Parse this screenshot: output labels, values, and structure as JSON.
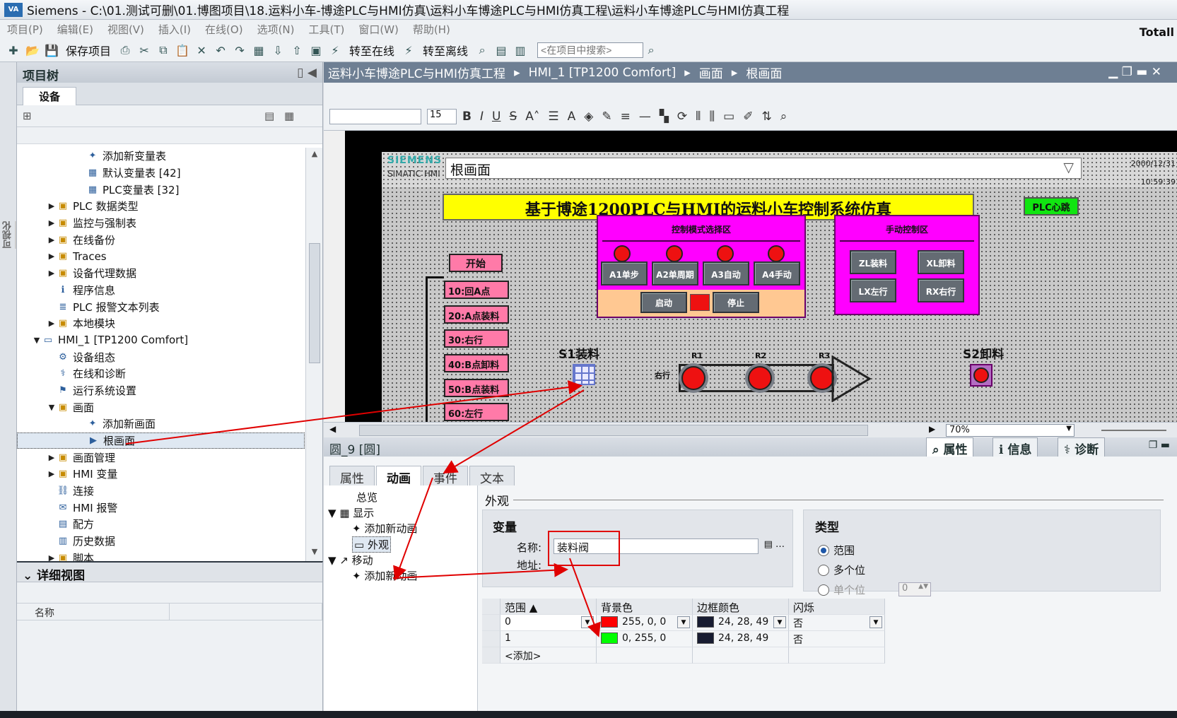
{
  "window": {
    "title": "Siemens  -  C:\\01.测试可删\\01.博图项目\\18.运料小车-博途PLC与HMI仿真\\运料小车博途PLC与HMI仿真工程\\运料小车博途PLC与HMI仿真工程",
    "logo": "VA V14",
    "brand": "Totall"
  },
  "menu": [
    "项目(P)",
    "编辑(E)",
    "视图(V)",
    "插入(I)",
    "在线(O)",
    "选项(N)",
    "工具(T)",
    "窗口(W)",
    "帮助(H)"
  ],
  "toolbar": {
    "save_label": "保存项目",
    "go_online": "转至在线",
    "go_offline": "转至离线",
    "search_placeholder": "<在项目中搜索>"
  },
  "left_strip": {
    "label": "可视化"
  },
  "project_tree": {
    "title": "项目树",
    "tab": "设备",
    "items": [
      {
        "label": "添加新变量表",
        "indent": 4,
        "arrow": "",
        "icon": "add-icon"
      },
      {
        "label": "默认变量表 [42]",
        "indent": 4,
        "arrow": "",
        "icon": "table-icon"
      },
      {
        "label": "PLC变量表 [32]",
        "indent": 4,
        "arrow": "",
        "icon": "table-icon"
      },
      {
        "label": "PLC 数据类型",
        "indent": 2,
        "arrow": "▶",
        "icon": "folder-icon"
      },
      {
        "label": "监控与强制表",
        "indent": 2,
        "arrow": "▶",
        "icon": "folder-icon"
      },
      {
        "label": "在线备份",
        "indent": 2,
        "arrow": "▶",
        "icon": "folder-icon"
      },
      {
        "label": "Traces",
        "indent": 2,
        "arrow": "▶",
        "icon": "folder-icon"
      },
      {
        "label": "设备代理数据",
        "indent": 2,
        "arrow": "▶",
        "icon": "folder-icon"
      },
      {
        "label": "程序信息",
        "indent": 2,
        "arrow": "",
        "icon": "info-icon"
      },
      {
        "label": "PLC 报警文本列表",
        "indent": 2,
        "arrow": "",
        "icon": "list-icon"
      },
      {
        "label": "本地模块",
        "indent": 2,
        "arrow": "▶",
        "icon": "folder-icon"
      },
      {
        "label": "HMI_1 [TP1200 Comfort]",
        "indent": 1,
        "arrow": "▼",
        "icon": "hmi-icon"
      },
      {
        "label": "设备组态",
        "indent": 2,
        "arrow": "",
        "icon": "config-icon"
      },
      {
        "label": "在线和诊断",
        "indent": 2,
        "arrow": "",
        "icon": "diag-icon"
      },
      {
        "label": "运行系统设置",
        "indent": 2,
        "arrow": "",
        "icon": "settings-icon"
      },
      {
        "label": "画面",
        "indent": 2,
        "arrow": "▼",
        "icon": "folder-icon"
      },
      {
        "label": "添加新画面",
        "indent": 4,
        "arrow": "",
        "icon": "add-icon"
      },
      {
        "label": "根画面",
        "indent": 4,
        "arrow": "",
        "icon": "screen-icon",
        "selected": true
      },
      {
        "label": "画面管理",
        "indent": 2,
        "arrow": "▶",
        "icon": "folder-icon"
      },
      {
        "label": "HMI 变量",
        "indent": 2,
        "arrow": "▶",
        "icon": "folder-icon"
      },
      {
        "label": "连接",
        "indent": 2,
        "arrow": "",
        "icon": "link-icon"
      },
      {
        "label": "HMI 报警",
        "indent": 2,
        "arrow": "",
        "icon": "alarm-icon"
      },
      {
        "label": "配方",
        "indent": 2,
        "arrow": "",
        "icon": "recipe-icon"
      },
      {
        "label": "历史数据",
        "indent": 2,
        "arrow": "",
        "icon": "history-icon"
      },
      {
        "label": "脚本",
        "indent": 2,
        "arrow": "▶",
        "icon": "folder-icon"
      }
    ]
  },
  "details": {
    "title": "详细视图",
    "col_name": "名称"
  },
  "breadcrumb": [
    "运料小车博途PLC与HMI仿真工程",
    "HMI_1 [TP1200 Comfort]",
    "画面",
    "根画面"
  ],
  "format": {
    "size": "15"
  },
  "hmi": {
    "siemens": "SIEMENS",
    "simatic": "SIMATIC HMI",
    "screen_name": "根画面",
    "date": "2000/12/31",
    "time": "10:59:39",
    "main_title": "基于博途1200PLC与HMI的运料小车控制系统仿真",
    "plc_heartbeat": "PLC心跳",
    "mode_area": "控制模式选择区",
    "modes": [
      "A1单步",
      "A2单周期",
      "A3自动",
      "A4手动"
    ],
    "start": "启动",
    "stop": "停止",
    "manual_area": "手动控制区",
    "manual_buttons": [
      "ZL装料",
      "XL卸料",
      "LX左行",
      "RX右行"
    ],
    "seq_start": "开始",
    "steps": [
      "10:回A点",
      "20:A点装料",
      "30:右行",
      "40:B点卸料",
      "50:B点装料",
      "60:左行"
    ],
    "s1": "S1装料",
    "s2": "S2卸料",
    "right_label": "右行",
    "r1": "R1",
    "r2": "R2",
    "r3": "R3"
  },
  "zoom": "70%",
  "properties": {
    "object": "圆_9 [圆]",
    "tabs": [
      "属性",
      "信息",
      "诊断"
    ],
    "subtabs": [
      "属性",
      "动画",
      "事件",
      "文本"
    ],
    "nav": {
      "overview": "总览",
      "display": "显示",
      "add_anim1": "添加新动画",
      "appearance": "外观",
      "move": "移动",
      "add_anim2": "添加新动画"
    },
    "section": "外观",
    "var_title": "变量",
    "name_label": "名称:",
    "name_value": "装料阀",
    "addr_label": "地址:",
    "type_title": "类型",
    "type_range": "范围",
    "type_multi": "多个位",
    "type_single": "单个位",
    "single_value": "0",
    "columns": [
      "范围",
      "背景色",
      "边框颜色",
      "闪烁"
    ],
    "rows": [
      {
        "range": "0",
        "bg": "255, 0, 0",
        "bg_color": "#ff0000",
        "border": "24, 28, 49",
        "border_color": "#181c31",
        "blink": "否"
      },
      {
        "range": "1",
        "bg": "0, 255, 0",
        "bg_color": "#00ff00",
        "border": "24, 28, 49",
        "border_color": "#181c31",
        "blink": "否"
      }
    ],
    "add_row": "<添加>"
  }
}
